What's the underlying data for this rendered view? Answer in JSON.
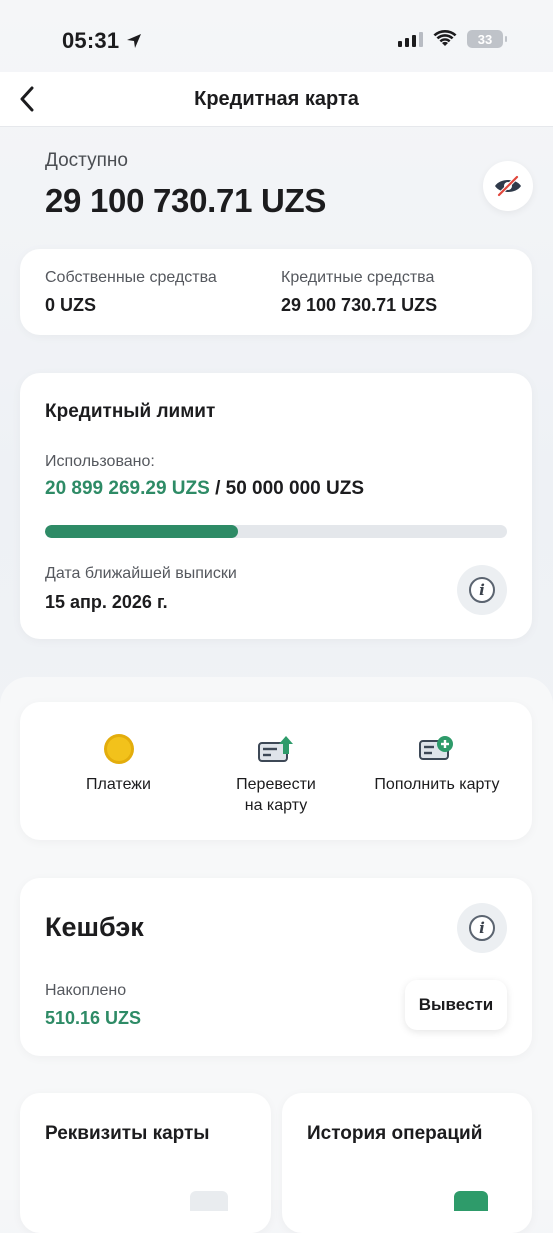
{
  "status_bar": {
    "time": "05:31",
    "battery": "33"
  },
  "header": {
    "title": "Кредитная карта"
  },
  "balance": {
    "label": "Доступно",
    "value": "29 100 730.71 UZS"
  },
  "funds": {
    "own_label": "Собственные средства",
    "own_value": "0 UZS",
    "credit_label": "Кредитные средства",
    "credit_value": "29 100 730.71 UZS"
  },
  "credit_limit": {
    "title": "Кредитный лимит",
    "used_label": "Использовано:",
    "used_value": "20 899 269.29 UZS",
    "separator": " / ",
    "total_value": "50 000 000 UZS",
    "used_fraction": 0.418,
    "statement_label": "Дата ближайшей выписки",
    "statement_date": "15 апр. 2026 г."
  },
  "actions": [
    {
      "label": "Платежи",
      "icon": "coin-icon"
    },
    {
      "label": "Перевести\nна карту",
      "icon": "card-transfer-icon"
    },
    {
      "label": "Пополнить карту",
      "icon": "card-topup-icon"
    }
  ],
  "cashback": {
    "title": "Кешбэк",
    "accrued_label": "Накоплено",
    "accrued_value": "510.16 UZS",
    "withdraw_label": "Вывести"
  },
  "tiles": {
    "details_title": "Реквизиты карты",
    "history_title": "История операций"
  },
  "colors": {
    "accent_green": "#2e8b66",
    "coin_yellow": "#f2c21b"
  }
}
